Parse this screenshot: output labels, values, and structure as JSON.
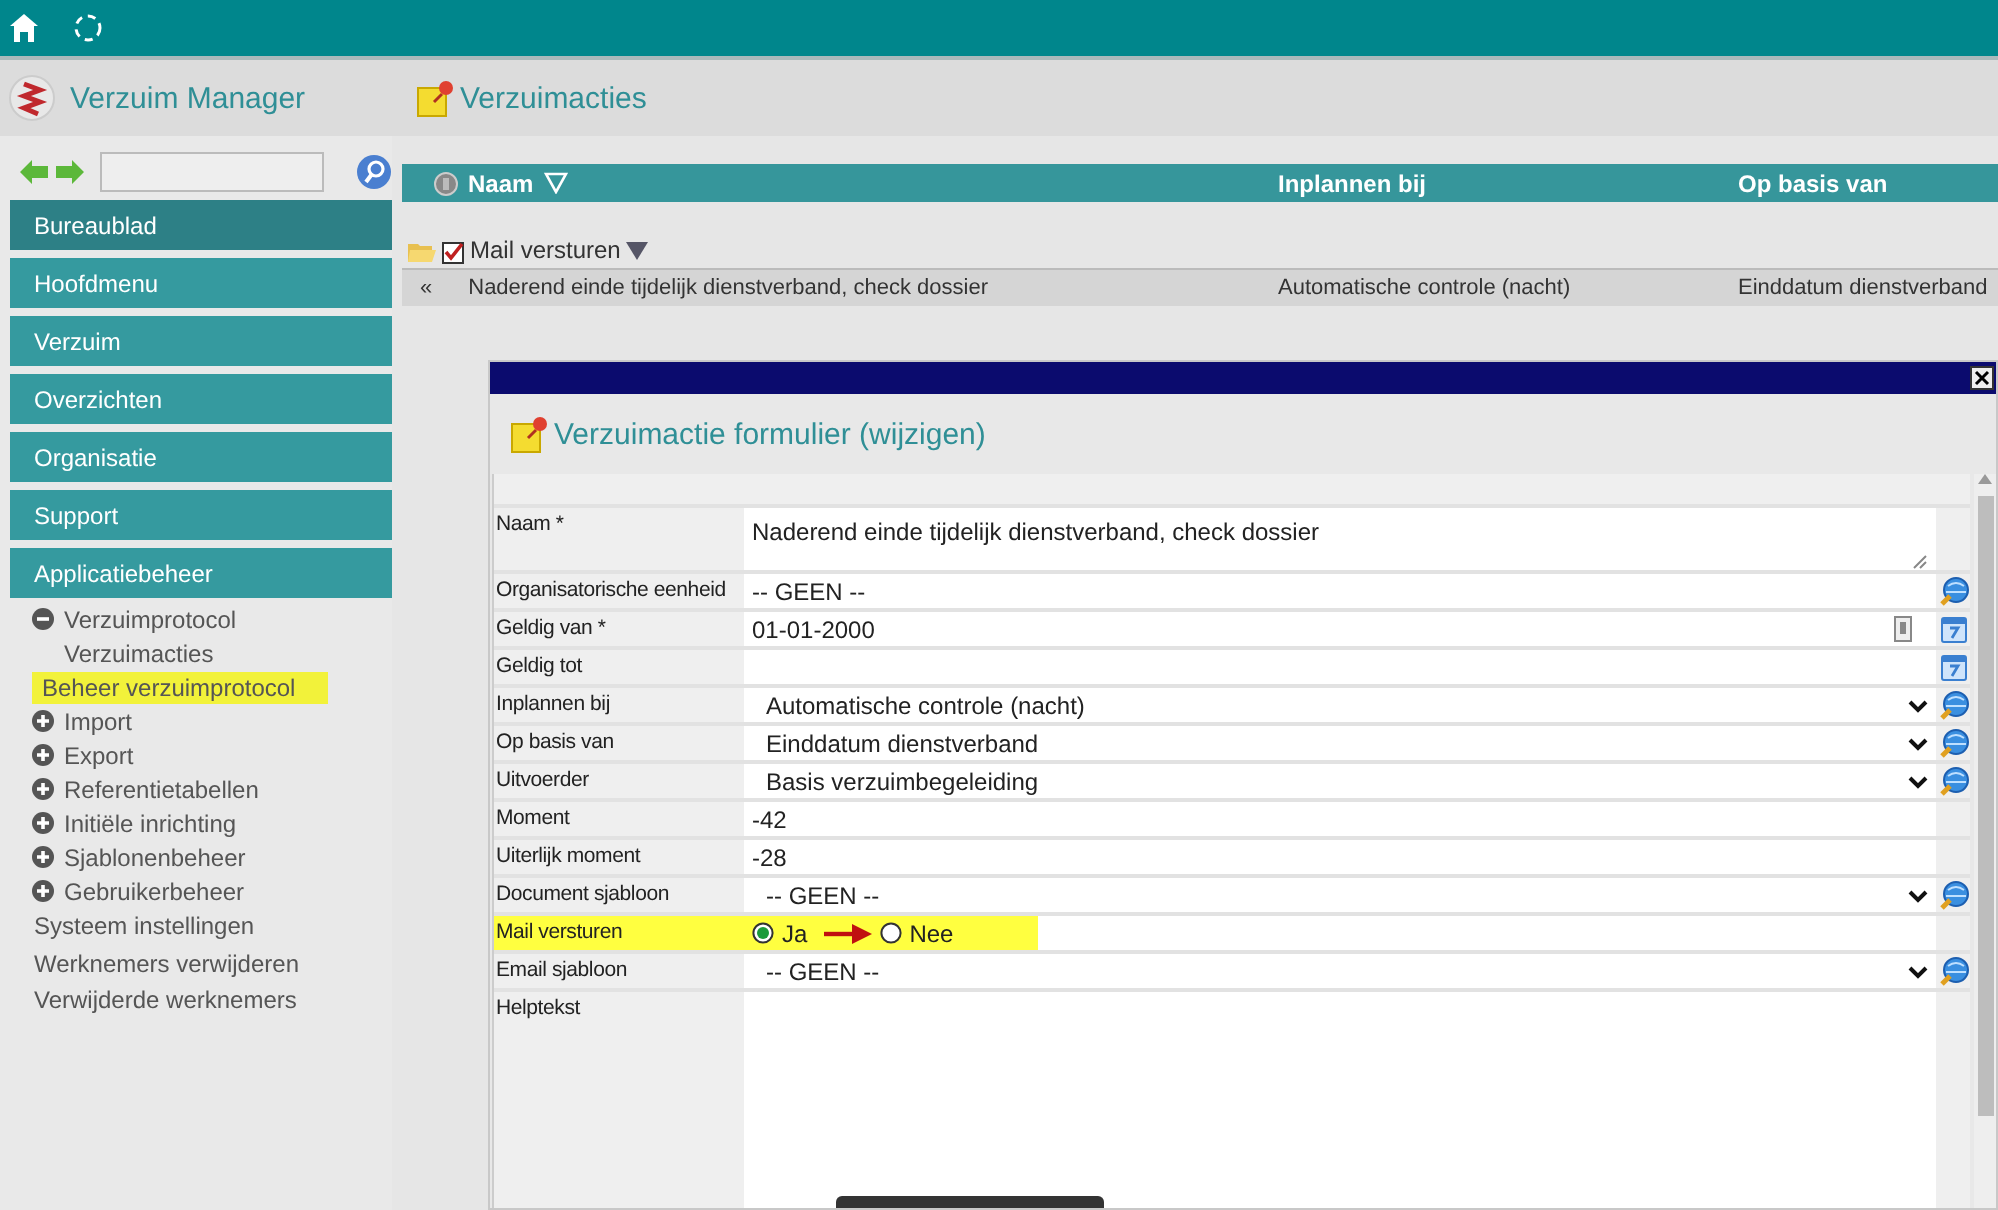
{
  "app": {
    "title": "Verzuim Manager"
  },
  "page": {
    "title": "Verzuimacties"
  },
  "sidebar": {
    "menu": [
      {
        "label": "Bureaublad",
        "selected": true
      },
      {
        "label": "Hoofdmenu",
        "selected": false
      },
      {
        "label": "Verzuim",
        "selected": false
      },
      {
        "label": "Overzichten",
        "selected": false
      },
      {
        "label": "Organisatie",
        "selected": false
      },
      {
        "label": "Support",
        "selected": false
      },
      {
        "label": "Applicatiebeheer",
        "selected": false
      }
    ],
    "tree": [
      {
        "label": "Verzuimprotocol",
        "expanded": true,
        "selected": false,
        "children": [
          {
            "label": "Verzuimacties",
            "selected": false
          },
          {
            "label": "Beheer verzuimprotocol",
            "selected": true
          }
        ]
      },
      {
        "label": "Import",
        "expanded": false,
        "selected": false
      },
      {
        "label": "Export",
        "expanded": false,
        "selected": false
      },
      {
        "label": "Referentietabellen",
        "expanded": false,
        "selected": false
      },
      {
        "label": "Initiële inrichting",
        "expanded": false,
        "selected": false
      },
      {
        "label": "Sjablonenbeheer",
        "expanded": false,
        "selected": false
      },
      {
        "label": "Gebruikerbeheer",
        "expanded": false,
        "selected": false
      },
      {
        "label": "Systeem instellingen",
        "selected": false
      },
      {
        "label": "Werknemers verwijderen",
        "selected": false
      },
      {
        "label": "Verwijderde werknemers",
        "selected": false
      }
    ]
  },
  "table": {
    "columns": [
      "Naam",
      "Inplannen bij",
      "Op basis van"
    ],
    "group": {
      "label": "Mail versturen",
      "checked": true
    },
    "rows": [
      {
        "marker": "«",
        "cells": [
          "Naderend einde tijdelijk dienstverband, check dossier",
          "Automatische controle (nacht)",
          "Einddatum dienstverband"
        ]
      }
    ]
  },
  "dialog": {
    "title": "Verzuimactie formulier (wijzigen)",
    "fields": [
      {
        "label": "Naam *",
        "kind": "textarea",
        "value": "Naderend einde tijdelijk dienstverband, check dossier"
      },
      {
        "label": "Organisatorische eenheid",
        "kind": "text",
        "value": "-- GEEN --",
        "action": {
          "kind": "lookup"
        }
      },
      {
        "label": "Geldig van *",
        "kind": "date",
        "value": "01-01-2000",
        "action": {
          "kind": "calendar"
        }
      },
      {
        "label": "Geldig tot",
        "kind": "text",
        "action": {
          "kind": "calendar"
        }
      },
      {
        "label": "Inplannen bij",
        "kind": "select",
        "value": "Automatische controle (nacht)",
        "action": {
          "kind": "lookup"
        }
      },
      {
        "label": "Op basis van",
        "kind": "select",
        "value": "Einddatum dienstverband",
        "action": {
          "kind": "lookup"
        }
      },
      {
        "label": "Uitvoerder",
        "kind": "select",
        "value": "Basis verzuimbegeleiding",
        "action": {
          "kind": "lookup"
        }
      },
      {
        "label": "Moment",
        "kind": "text",
        "value": "-42"
      },
      {
        "label": "Uiterlijk moment",
        "kind": "text",
        "value": "-28"
      },
      {
        "label": "Document sjabloon",
        "kind": "select",
        "value": "-- GEEN --",
        "action": {
          "kind": "lookup"
        }
      },
      {
        "label": "Mail versturen",
        "kind": "radio",
        "highlighted": true,
        "arrow": true,
        "options": [
          {
            "label": "Ja",
            "selected": true
          },
          {
            "label": "Nee",
            "selected": false
          }
        ]
      },
      {
        "label": "Email sjabloon",
        "kind": "select",
        "value": "-- GEEN --",
        "action": {
          "kind": "lookup"
        }
      },
      {
        "label": "Helptekst",
        "kind": "area"
      }
    ]
  }
}
